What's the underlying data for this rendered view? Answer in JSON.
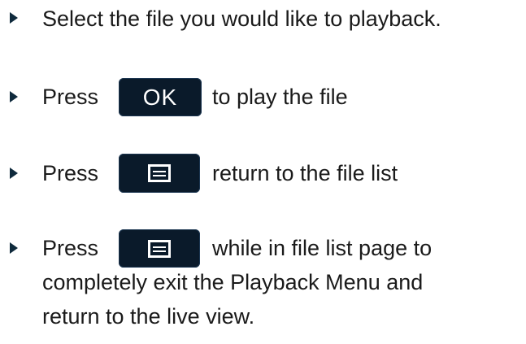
{
  "steps": [
    {
      "text": "Select the file you would like to playback."
    },
    {
      "press": "Press",
      "key_label": "OK",
      "after": "to play the file"
    },
    {
      "press": "Press",
      "key_icon": "menu-icon",
      "after": "return to the file list"
    },
    {
      "press": "Press",
      "key_icon": "menu-icon",
      "after": "while in file list page to",
      "line2": "completely exit the Playback Menu and",
      "line3": "return to the live view."
    }
  ],
  "colors": {
    "key_background": "#0a1a2a",
    "bullet": "#0f2a3c",
    "text": "#1a1a1a"
  }
}
